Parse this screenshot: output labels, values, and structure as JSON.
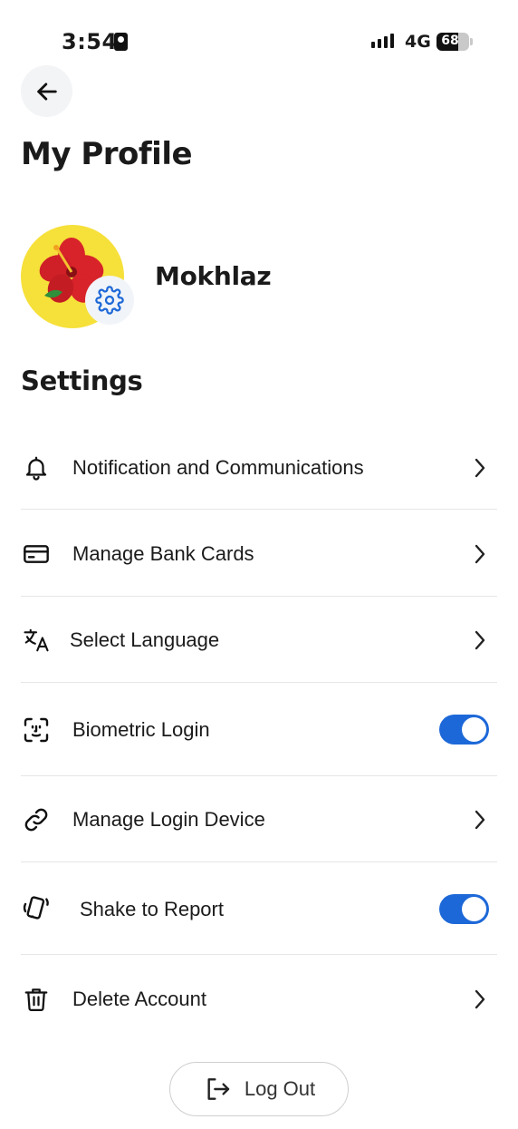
{
  "status_bar": {
    "time": "3:54",
    "network": "4G",
    "battery_level": "68",
    "battery_fraction": 0.68
  },
  "header": {
    "title": "My Profile",
    "back_icon": "arrow-left-icon"
  },
  "profile": {
    "name": "Mokhlaz",
    "avatar_icon": "hibiscus-avatar",
    "badge_icon": "gear-icon"
  },
  "settings": {
    "title": "Settings",
    "items": [
      {
        "label": "Notification and Communications",
        "icon": "bell-icon",
        "control": "chevron"
      },
      {
        "label": "Manage Bank Cards",
        "icon": "card-icon",
        "control": "chevron"
      },
      {
        "label": "Select Language",
        "icon": "translate-icon",
        "control": "chevron"
      },
      {
        "label": "Biometric Login",
        "icon": "face-scan-icon",
        "control": "toggle",
        "enabled": true
      },
      {
        "label": "Manage Login Device",
        "icon": "link-icon",
        "control": "chevron"
      },
      {
        "label": "Shake to Report",
        "icon": "shake-phone-icon",
        "control": "toggle",
        "enabled": true
      },
      {
        "label": "Delete Account",
        "icon": "trash-icon",
        "control": "chevron"
      }
    ]
  },
  "logout": {
    "label": "Log Out",
    "icon": "logout-icon"
  },
  "colors": {
    "accent": "#1d68d8",
    "avatar_bg": "#f6e03a",
    "text": "#1b1b1b",
    "divider": "#e6e6e6"
  }
}
